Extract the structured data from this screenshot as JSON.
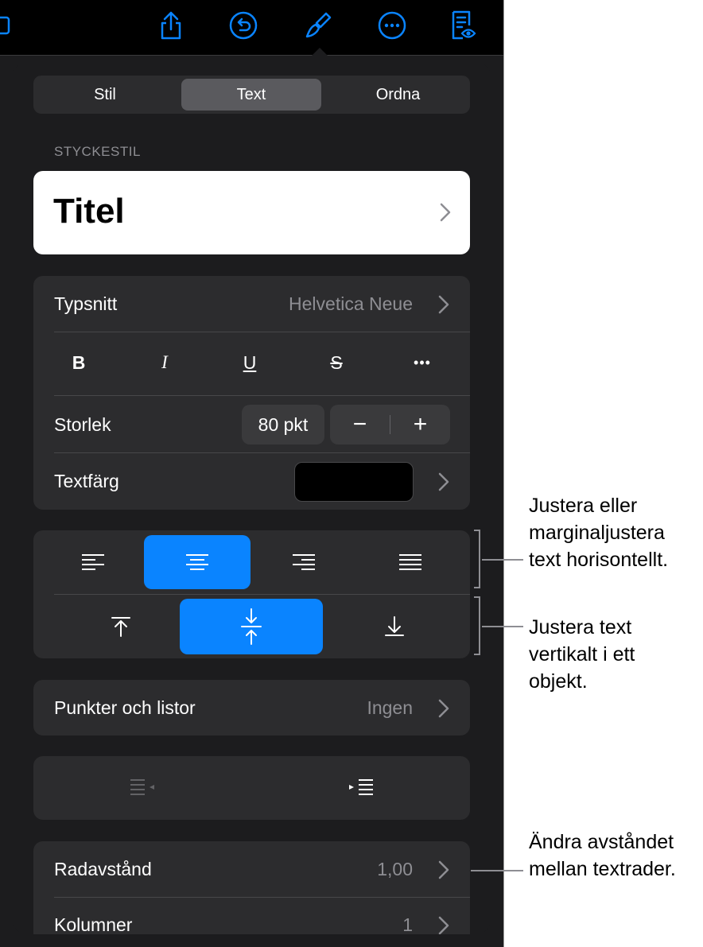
{
  "toolbar": {
    "icons": [
      "photo-icon",
      "share-icon",
      "undo-icon",
      "format-brush-icon",
      "more-icon",
      "document-view-icon"
    ]
  },
  "tabs": {
    "stil": "Stil",
    "text": "Text",
    "ordna": "Ordna",
    "active": "Text"
  },
  "paragraph_style": {
    "label": "STYCKESTIL",
    "value": "Titel"
  },
  "font": {
    "label": "Typsnitt",
    "value": "Helvetica Neue",
    "bold": "B",
    "italic": "I",
    "underline": "U",
    "strike": "S",
    "more": "•••",
    "size_label": "Storlek",
    "size_value": "80 pkt",
    "minus": "−",
    "plus": "+",
    "color_label": "Textfärg",
    "color_value": "#000000"
  },
  "alignment": {
    "horizontal": [
      "left",
      "center",
      "right",
      "justify"
    ],
    "horizontal_selected": "center",
    "vertical": [
      "top",
      "middle",
      "bottom"
    ],
    "vertical_selected": "middle",
    "accent": "#0a84ff"
  },
  "bullets": {
    "label": "Punkter och listor",
    "value": "Ingen"
  },
  "spacing": {
    "line_label": "Radavstånd",
    "line_value": "1,00",
    "columns_label": "Kolumner",
    "columns_value": "1"
  },
  "annotations": {
    "horizontal": [
      "Justera eller",
      "marginaljustera",
      "text horisontellt."
    ],
    "vertical": [
      "Justera text",
      "vertikalt i ett",
      "objekt."
    ],
    "spacing": [
      "Ändra avståndet",
      "mellan textrader."
    ]
  }
}
